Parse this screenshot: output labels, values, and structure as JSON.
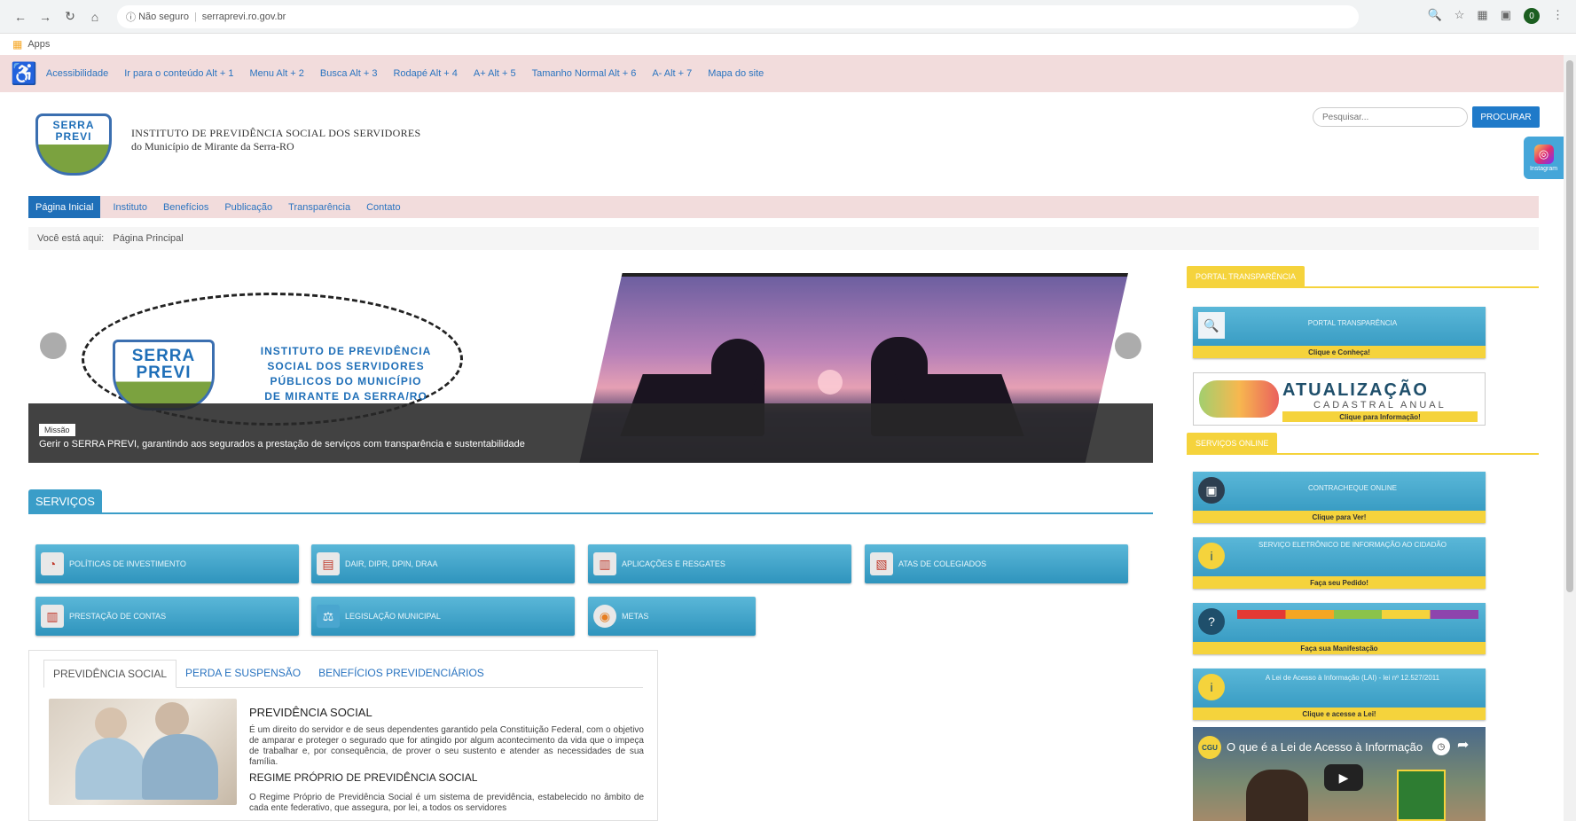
{
  "browser": {
    "url_security": "Não seguro",
    "url": "serraprevi.ro.gov.br",
    "profile_initial": "0",
    "bookmarks_apps": "Apps"
  },
  "accessibility": {
    "links": [
      "Acessibilidade",
      "Ir para o conteúdo Alt + 1",
      "Menu Alt + 2",
      "Busca Alt + 3",
      "Rodapé Alt + 4",
      "A+ Alt + 5",
      "Tamanho Normal Alt + 6",
      "A- Alt + 7",
      "Mapa do site"
    ]
  },
  "header": {
    "logo_line1": "SERRA",
    "logo_line2": "PREVI",
    "title": "INSTITUTO DE PREVIDÊNCIA SOCIAL DOS SERVIDORES",
    "subtitle": "do Município de Mirante da Serra-RO",
    "search_placeholder": "Pesquisar...",
    "search_button": "PROCURAR",
    "instagram_label": "Instagram"
  },
  "nav": {
    "items": [
      "Página Inicial",
      "Instituto",
      "Benefícios",
      "Publicação",
      "Transparência",
      "Contato"
    ]
  },
  "breadcrumb": {
    "label": "Você está aqui:",
    "current": "Página Principal"
  },
  "slider": {
    "badge_line1": "SERRA",
    "badge_line2": "PREVI",
    "text_lines": [
      "INSTITUTO DE PREVIDÊNCIA",
      "SOCIAL DOS SERVIDORES",
      "PÚBLICOS DO MUNICÍPIO",
      "DE MIRANTE DA SERRA/RO"
    ],
    "caption_tag": "Missão",
    "caption": "Gerir o SERRA PREVI, garantindo aos segurados a prestação de serviços com transparência e sustentabilidade"
  },
  "services": {
    "title": "SERVIÇOS",
    "items": [
      {
        "label": "Políticas de Investimento",
        "icon": "pie-chart-icon"
      },
      {
        "label": "DAIR, DIPR, DPIN, DRAA",
        "icon": "report-icon"
      },
      {
        "label": "Aplicações e Resgates",
        "icon": "bar-chart-icon"
      },
      {
        "label": "Atas de Colegiados",
        "icon": "document-icon"
      },
      {
        "label": "Prestação de Contas",
        "icon": "chart-icon"
      },
      {
        "label": "Legislação Municipal",
        "icon": "gavel-icon"
      },
      {
        "label": "Metas",
        "icon": "target-icon"
      }
    ]
  },
  "tabs": {
    "items": [
      "PREVIDÊNCIA SOCIAL",
      "PERDA E SUSPENSÃO",
      "BENEFÍCIOS PREVIDENCIÁRIOS"
    ],
    "heading1": "PREVIDÊNCIA SOCIAL",
    "para1": "É um direito do servidor e de seus dependentes garantido pela Constituição Federal, com o objetivo de amparar e proteger o segurado que for atingido por algum acontecimento da vida que o impeça de trabalhar e, por consequência, de prover o seu sustento e atender as necessidades de sua família.",
    "heading2": "REGIME PRÓPRIO DE PREVIDÊNCIA SOCIAL",
    "para2": "O Regime Próprio de Previdência Social é um sistema de previdência, estabelecido no âmbito de cada ente federativo, que assegura, por lei, a todos os servidores"
  },
  "sidebar": {
    "tag1": "PORTAL TRANSPARÊNCIA",
    "tag2": "SERVIÇOS ONLINE",
    "card_transparencia_title": "PORTAL TRANSPARÊNCIA",
    "card_transparencia_foot": "Clique e Conheça!",
    "atual_title": "ATUALIZAÇÃO",
    "atual_sub": "CADASTRAL ANUAL",
    "atual_foot": "Clique para Informação!",
    "card_contracheque_title": "CONTRACHEQUE ONLINE",
    "card_contracheque_foot": "Clique para Ver!",
    "card_esic_title": "SERVIÇO ELETRÔNICO DE INFORMAÇÃO AO CIDADÃO",
    "card_esic_foot": "Faça seu Pedido!",
    "card_ouvidoria_foot": "Faça sua Manifestação",
    "card_lai_title": "A Lei de Acesso à Informação (LAI) - lei nº 12.527/2011",
    "card_lai_foot": "Clique e acesse a Lei!",
    "video_badge": "CGU",
    "video_title": "O que é a Lei de Acesso à Informação"
  }
}
